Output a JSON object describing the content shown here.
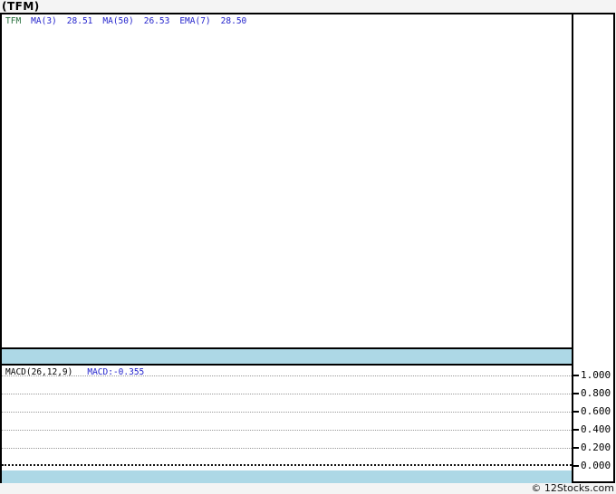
{
  "title": "(TFM)",
  "legend": {
    "ticker": "TFM",
    "items": [
      {
        "label": "MA(3)",
        "value": "28.51"
      },
      {
        "label": "MA(50)",
        "value": "26.53"
      },
      {
        "label": "EMA(7)",
        "value": "28.50"
      }
    ]
  },
  "macd": {
    "label": "MACD(26,12,9)",
    "value": "MACD:-0.355",
    "yticks": [
      "1.000",
      "0.800",
      "0.600",
      "0.400",
      "0.200",
      "0.000"
    ]
  },
  "footer": {
    "credit": "© 12Stocks.com"
  },
  "colors": {
    "band": "#add8e6",
    "legend_blue": "#2222cc",
    "ticker_green": "#256d3a",
    "grid_gray": "#999999",
    "border": "#000000",
    "page_background": "#f4f4f4"
  },
  "chart_data": [
    {
      "type": "line",
      "panel": "price",
      "title": "(TFM)",
      "series": [
        {
          "name": "TFM",
          "values": []
        },
        {
          "name": "MA(3)",
          "last": 28.51,
          "values": []
        },
        {
          "name": "MA(50)",
          "last": 26.53,
          "values": []
        },
        {
          "name": "EMA(7)",
          "last": 28.5,
          "values": []
        }
      ],
      "legend_position": "top-left",
      "note": "no price data plotted in visible range"
    },
    {
      "type": "line",
      "panel": "MACD",
      "series": [
        {
          "name": "MACD(26,12,9)",
          "last": -0.355,
          "values": []
        }
      ],
      "ylim": [
        0.0,
        1.0
      ],
      "yticks": [
        1.0,
        0.8,
        0.6,
        0.4,
        0.2,
        0.0
      ],
      "grid": "horizontal dotted, zero line emphasized",
      "legend_position": "top-left",
      "note": "no MACD line plotted in visible range"
    }
  ]
}
